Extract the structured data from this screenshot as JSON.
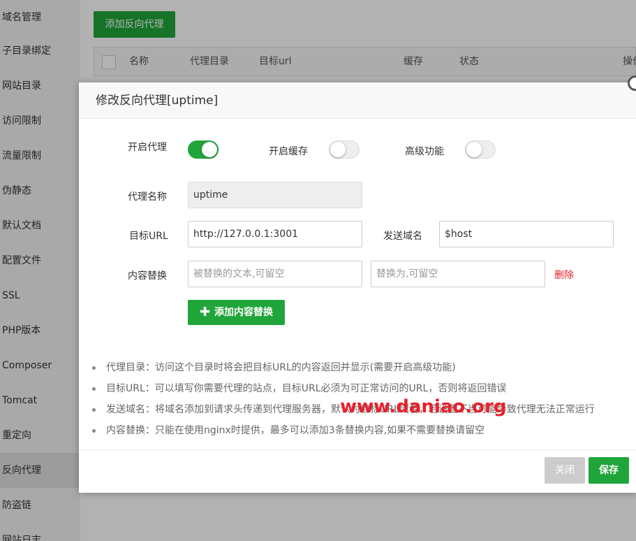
{
  "sidebar": {
    "items": [
      {
        "label": "域名管理"
      },
      {
        "label": "子目录绑定"
      },
      {
        "label": "网站目录"
      },
      {
        "label": "访问限制"
      },
      {
        "label": "流量限制"
      },
      {
        "label": "伪静态"
      },
      {
        "label": "默认文档"
      },
      {
        "label": "配置文件"
      },
      {
        "label": "SSL"
      },
      {
        "label": "PHP版本"
      },
      {
        "label": "Composer"
      },
      {
        "label": "Tomcat"
      },
      {
        "label": "重定向"
      },
      {
        "label": "反向代理"
      },
      {
        "label": "防盗链"
      },
      {
        "label": "网站日志"
      }
    ],
    "active_label": "反向代理"
  },
  "main": {
    "add_button_label": "添加反向代理",
    "table_headers": [
      "名称",
      "代理目录",
      "目标url",
      "缓存",
      "状态",
      "操作"
    ]
  },
  "modal": {
    "title": "修改反向代理[uptime]",
    "enable_proxy_label": "开启代理",
    "enable_proxy_on": true,
    "enable_cache_label": "开启缓存",
    "enable_cache_on": false,
    "advanced_label": "高级功能",
    "advanced_on": false,
    "proxy_name_label": "代理名称",
    "proxy_name_value": "uptime",
    "target_url_label": "目标URL",
    "target_url_value": "http://127.0.0.1:3001",
    "send_domain_label": "发送域名",
    "send_domain_value": "$host",
    "content_replace_label": "内容替换",
    "replace_from_placeholder": "被替换的文本,可留空",
    "replace_to_placeholder": "替换为,可留空",
    "delete_label": "删除",
    "add_replace_label": "添加内容替换",
    "notes": [
      "代理目录：访问这个目录时将会把目标URL的内容返回并显示(需要开启高级功能)",
      "目标URL：可以填写你需要代理的站点，目标URL必须为可正常访问的URL，否则将返回错误",
      "发送域名：将域名添加到请求头传递到代理服务器，默认为目标URL域名，若设置不当可能导致代理无法正常运行",
      "内容替换：只能在使用nginx时提供，最多可以添加3条替换内容,如果不需要替换请留空"
    ],
    "close_label": "关闭",
    "save_label": "保存"
  },
  "watermark": "www.daniao.org",
  "colors": {
    "accent": "#20a53a",
    "danger": "#e02020",
    "watermark": "#e8202a"
  }
}
